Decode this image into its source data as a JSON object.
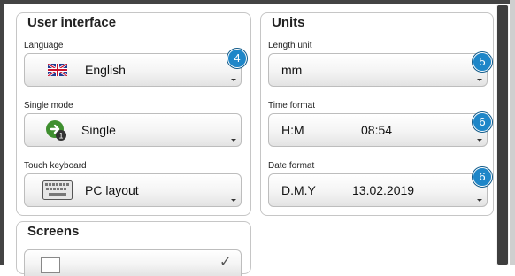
{
  "user_interface": {
    "title": "User interface",
    "language": {
      "label": "Language",
      "value": "English",
      "icon": "uk-flag-icon",
      "badge": "4"
    },
    "single_mode": {
      "label": "Single mode",
      "value": "Single",
      "icon": "single-mode-icon"
    },
    "touch_keyboard": {
      "label": "Touch keyboard",
      "value": "PC layout",
      "icon": "keyboard-icon"
    }
  },
  "units": {
    "title": "Units",
    "length_unit": {
      "label": "Length unit",
      "value": "mm",
      "badge": "5"
    },
    "time_format": {
      "label": "Time format",
      "value": "H:M",
      "preview": "08:54",
      "badge": "6"
    },
    "date_format": {
      "label": "Date format",
      "value": "D.M.Y",
      "preview": "13.02.2019",
      "badge": "6"
    }
  },
  "screens": {
    "title": "Screens"
  },
  "colors": {
    "badge": "#1e86c8",
    "panel_border": "#c6c6c6",
    "scroll_thumb": "#3e3e3e"
  }
}
